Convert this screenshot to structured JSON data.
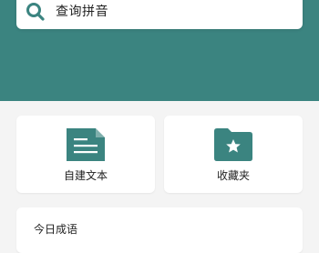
{
  "search": {
    "placeholder": "查询拼音"
  },
  "actions": [
    {
      "label": "自建文本",
      "icon": "document-icon"
    },
    {
      "label": "收藏夹",
      "icon": "star-folder-icon"
    }
  ],
  "idiom_section": {
    "title": "今日成语"
  },
  "colors": {
    "accent": "#3b8480",
    "icon": "#3b8480",
    "background": "#f4f4f4"
  }
}
